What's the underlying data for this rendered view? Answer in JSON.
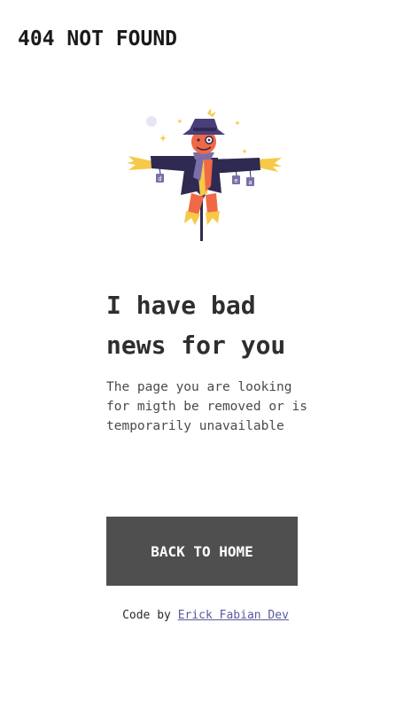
{
  "header": {
    "brand": "404 NOT FOUND"
  },
  "illustration": {
    "icon": "scarecrow-icon",
    "tag_letters": [
      "d",
      "e",
      "a"
    ]
  },
  "main": {
    "headline": "I have bad news for you",
    "description": "The page you are looking for migth be removed or is temporarily unavailable",
    "button_label": "BACK TO HOME"
  },
  "footer": {
    "credit_prefix": "Code by",
    "author_link": "Erick Fabian Dev"
  },
  "colors": {
    "button_bg": "#4f4f4f",
    "link": "#5a5aa0",
    "coat": "#2f2a52",
    "straw": "#f7c948",
    "face": "#f06846"
  }
}
